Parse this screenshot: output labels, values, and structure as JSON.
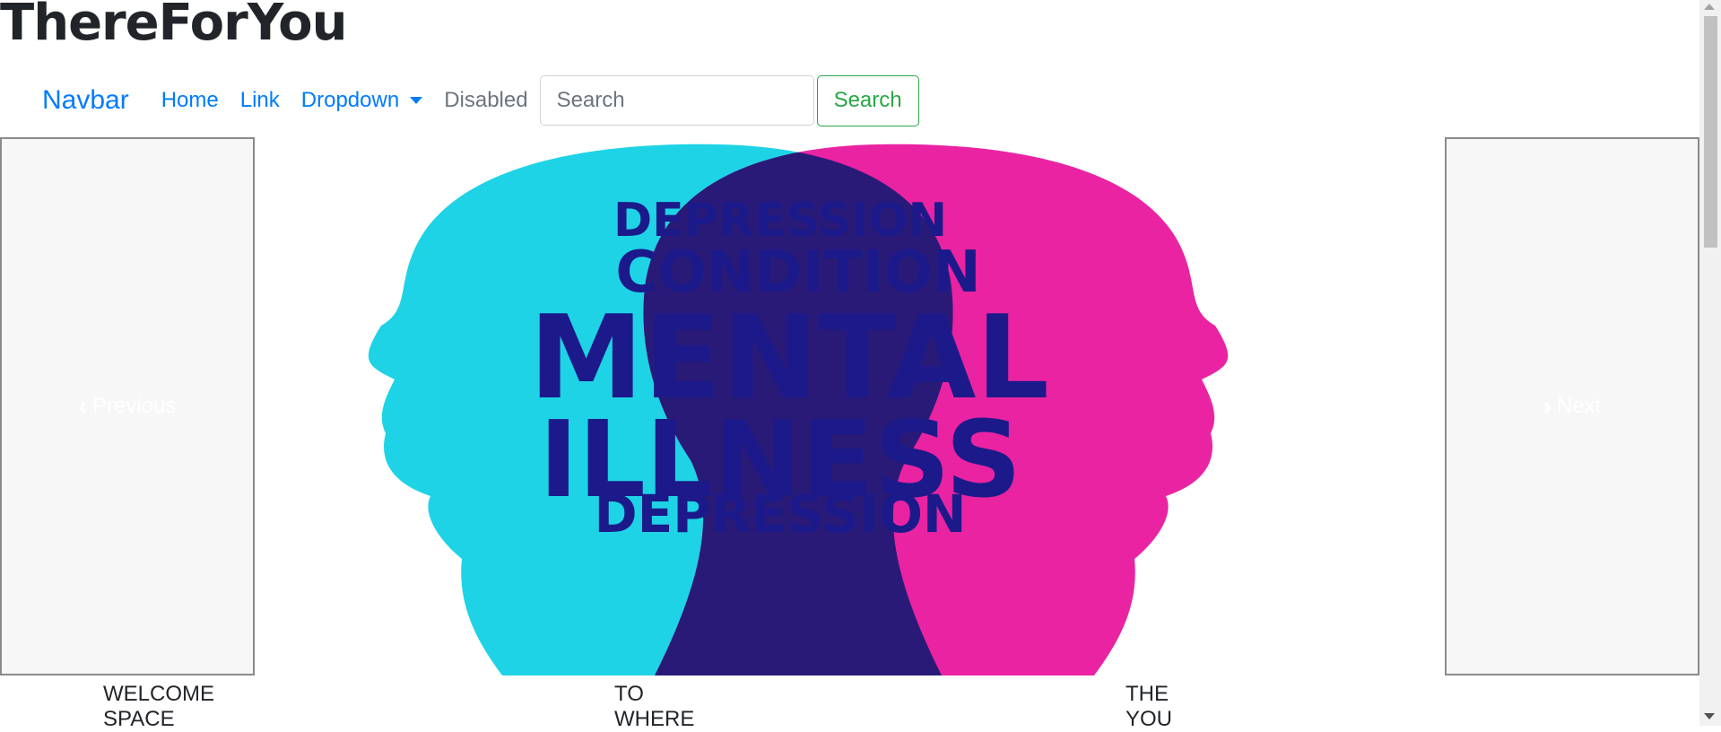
{
  "site_title": "ThereForYou",
  "navbar": {
    "brand": "Navbar",
    "links": [
      "Home",
      "Link",
      "Dropdown",
      "Disabled"
    ],
    "search_placeholder": "Search",
    "search_button": "Search"
  },
  "carousel": {
    "prev_label": "Previous",
    "next_label": "Next",
    "image_words": [
      "DEPRESSION",
      "CONDITION",
      "MENTAL",
      "ILLNESS",
      "DEPRESSION"
    ]
  },
  "columns": [
    {
      "line1": "WELCOME",
      "line2": "SPACE"
    },
    {
      "line1": "TO",
      "line2": "WHERE"
    },
    {
      "line1": "THE",
      "line2": "YOU"
    }
  ],
  "colors": {
    "primary": "#007bff",
    "success": "#28a745",
    "cyan_head": "#1ed3e6",
    "magenta_head": "#e8109a",
    "navy_text": "#1c1a8a"
  }
}
